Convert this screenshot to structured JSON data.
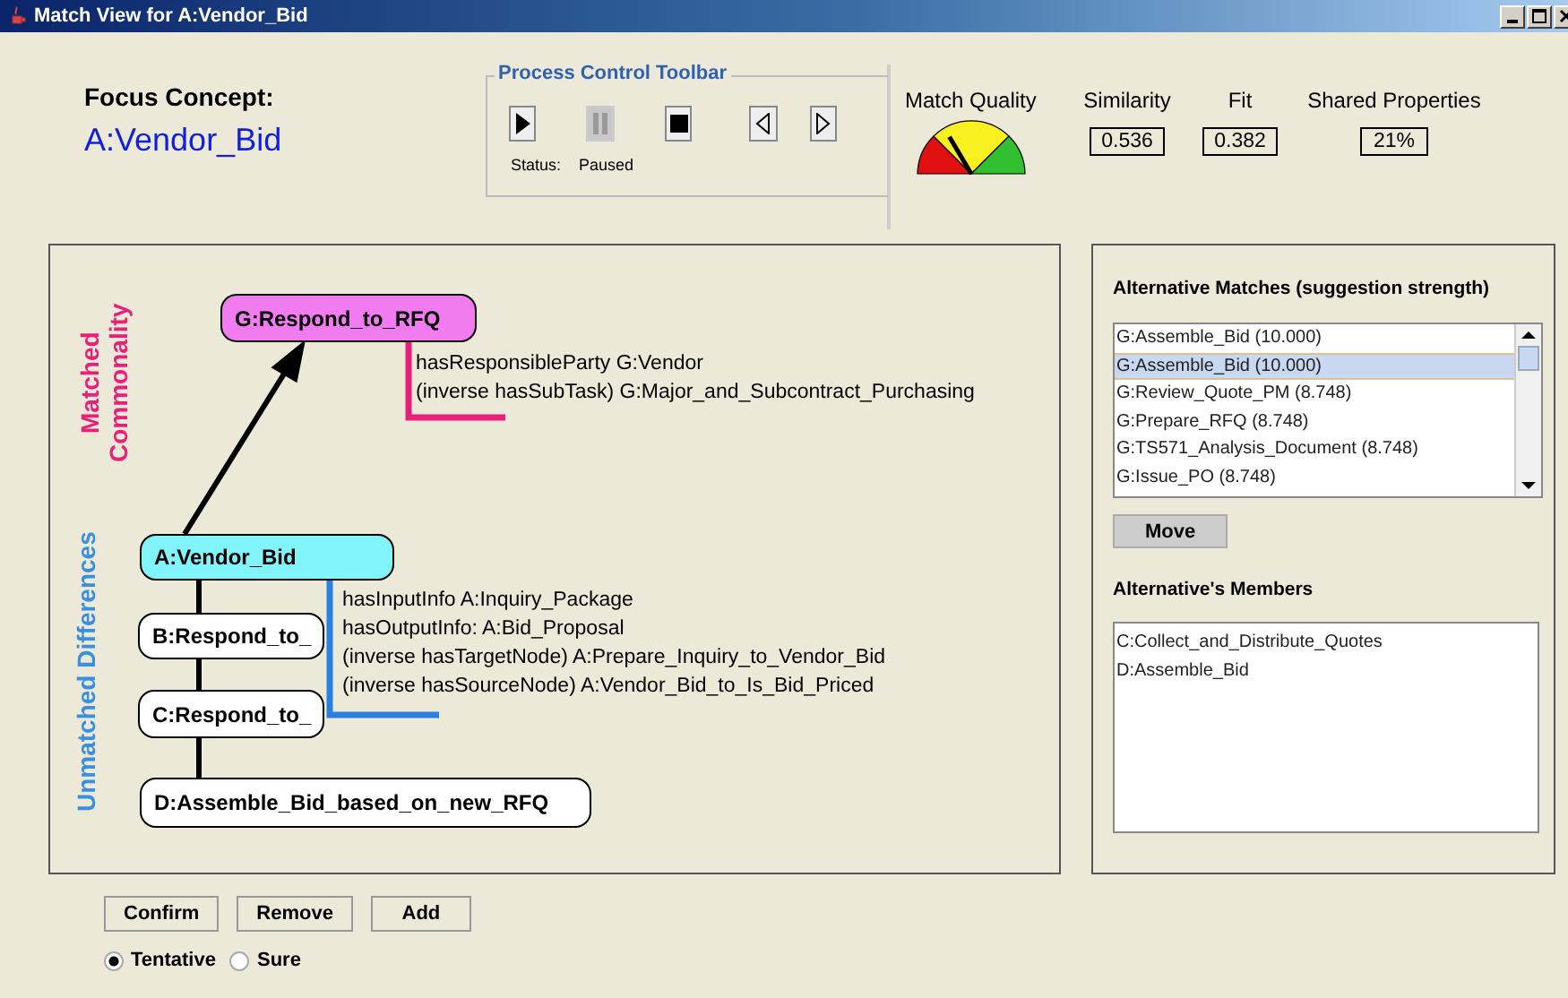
{
  "window": {
    "title": "Match View for A:Vendor_Bid"
  },
  "focus": {
    "label": "Focus Concept:",
    "value": "A:Vendor_Bid"
  },
  "toolbar": {
    "title": "Process Control Toolbar",
    "status_label": "Status:",
    "status_value": "Paused",
    "buttons": [
      {
        "kind": "play",
        "disabled": false
      },
      {
        "kind": "pause",
        "disabled": true
      },
      {
        "kind": "stop",
        "disabled": false
      },
      {
        "kind": "prev",
        "disabled": false
      },
      {
        "kind": "next",
        "disabled": false
      }
    ]
  },
  "metrics": {
    "match_quality": {
      "label": "Match Quality",
      "level": 0.33
    },
    "values": [
      {
        "label": "Similarity",
        "value": "0.536"
      },
      {
        "label": "Fit",
        "value": "0.382"
      },
      {
        "label": "Shared Properties",
        "value": "21%"
      }
    ]
  },
  "diagram": {
    "sections": [
      {
        "label": "Matched Commonality",
        "color": "#e8207a"
      },
      {
        "label": "Unmatched Differences",
        "color": "#3a8fe0"
      }
    ],
    "nodes": [
      {
        "label": "G:Respond_to_RFQ",
        "kind": "matched"
      },
      {
        "label": "A:Vendor_Bid",
        "kind": "focus"
      },
      {
        "label": "B:Respond_to_",
        "kind": "plain"
      },
      {
        "label": "C:Respond_to_",
        "kind": "plain"
      },
      {
        "label": "D:Assemble_Bid_based_on_new_RFQ",
        "kind": "plain"
      }
    ],
    "annotations": [
      {
        "color": "#e8207a",
        "lines": [
          "hasResponsibleParty G:Vendor",
          "(inverse hasSubTask) G:Major_and_Subcontract_Purchasing"
        ]
      },
      {
        "color": "#2a7fe0",
        "lines": [
          "hasInputInfo A:Inquiry_Package",
          "hasOutputInfo:  A:Bid_Proposal",
          "(inverse hasTargetNode) A:Prepare_Inquiry_to_Vendor_Bid",
          "(inverse hasSourceNode) A:Vendor_Bid_to_Is_Bid_Priced"
        ]
      }
    ]
  },
  "alternatives": {
    "title": "Alternative Matches (suggestion strength)",
    "items": [
      {
        "label": "G:Assemble_Bid (10.000)",
        "selected": false
      },
      {
        "label": "G:Assemble_Bid (10.000)",
        "selected": true
      },
      {
        "label": "G:Review_Quote_PM (8.748)",
        "selected": false
      },
      {
        "label": "G:Prepare_RFQ (8.748)",
        "selected": false
      },
      {
        "label": "G:TS571_Analysis_Document (8.748)",
        "selected": false
      },
      {
        "label": "G:Issue_PO (8.748)",
        "selected": false
      }
    ],
    "move_button": "Move"
  },
  "members": {
    "title": "Alternative's Members",
    "items": [
      "C:Collect_and_Distribute_Quotes",
      "D:Assemble_Bid"
    ]
  },
  "actions": [
    "Confirm",
    "Remove",
    "Add"
  ],
  "certainty": [
    {
      "label": "Tentative",
      "selected": true
    },
    {
      "label": "Sure",
      "selected": false
    }
  ]
}
